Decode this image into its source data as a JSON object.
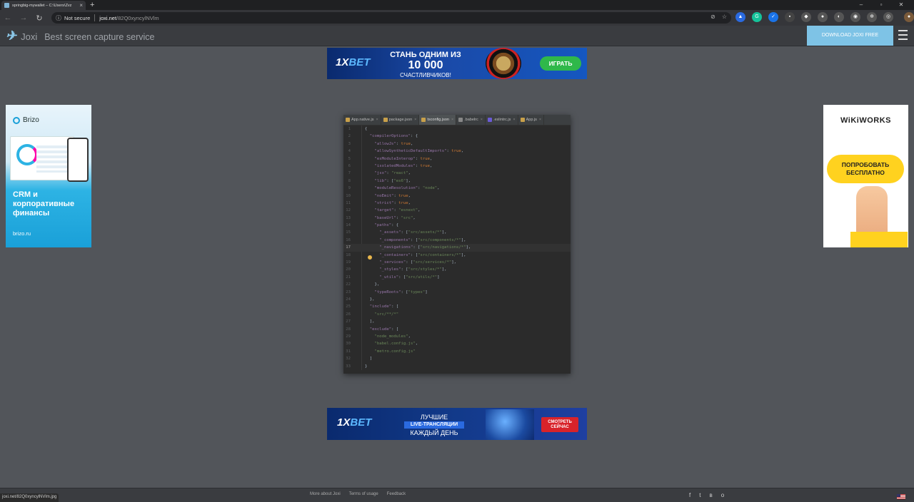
{
  "browser": {
    "tab_title": "springbig-mywallet – C:\\Users\\Zvz",
    "new_tab": "+",
    "security_label": "Not secure",
    "url_domain": "joxi.net",
    "url_path": "/82Q0xyncylNVlm",
    "status_url": "joxi.net/82Q0xyncylNVlm.jpg"
  },
  "joxi": {
    "logo": "Joxi",
    "tagline": "Best screen capture service",
    "download_label": "DOWNLOAD JOXI FREE"
  },
  "top_banner": {
    "brand_a": "1X",
    "brand_b": "BET",
    "line1": "СТАНЬ ОДНИМ ИЗ",
    "line2": "10 000",
    "line3": "СЧАСТЛИВЧИКОВ!",
    "cta": "ИГРАТЬ"
  },
  "bottom_banner": {
    "brand_a": "1X",
    "brand_b": "BET",
    "line1": "ЛУЧШИЕ",
    "line2": "LIVE-ТРАНСЛЯЦИИ",
    "line3": "КАЖДЫЙ ДЕНЬ",
    "cta_line1": "СМОТРЕТЬ",
    "cta_line2": "СЕЙЧАС"
  },
  "left_ad": {
    "brand": "Brizo",
    "text": "CRM и корпоративные финансы",
    "url": "brizo.ru"
  },
  "right_ad": {
    "brand": "WiKiWORKS",
    "cta": "ПОПРОБОВАТЬ БЕСПЛАТНО"
  },
  "editor": {
    "tabs": [
      {
        "label": "App.native.js",
        "active": false
      },
      {
        "label": "package.json",
        "active": false
      },
      {
        "label": "tsconfig.json",
        "active": true
      },
      {
        "label": ".babelrc",
        "active": false
      },
      {
        "label": ".eslintrc.js",
        "active": false
      },
      {
        "label": "App.js",
        "active": false
      }
    ],
    "current_line": 17,
    "lines": [
      "{",
      "  \"compilerOptions\": {",
      "    \"allowJs\": true,",
      "    \"allowSyntheticDefaultImports\": true,",
      "    \"esModuleInterop\": true,",
      "    \"isolatedModules\": true,",
      "    \"jsx\": \"react\",",
      "    \"lib\": [\"es6\"],",
      "    \"moduleResolution\": \"node\",",
      "    \"noEmit\": true,",
      "    \"strict\": true,",
      "    \"target\": \"esnext\",",
      "    \"baseUrl\": \"src\",",
      "    \"paths\": {",
      "      \"_assets\": [\"src/assets/*\"],",
      "      \"_components\": [\"src/components/*\"],",
      "      \"_navigations\": [\"src/navigations/*\"],",
      "      \"_containers\": [\"src/containers/*\"],",
      "      \"_services\": [\"src/services/*\"],",
      "      \"_styles\": [\"src/styles/*\"],",
      "      \"_utils\": [\"src/utils/*\"]",
      "    },",
      "    \"typeRoots\": [\"types\"]",
      "  },",
      "  \"include\": [",
      "    \"src/**/*\"",
      "  ],",
      "  \"exclude\": [",
      "    \"node_modules\",",
      "    \"babel.config.js\",",
      "    \"metro.config.js\"",
      "  ]",
      "}"
    ]
  },
  "footer": {
    "links": [
      "More about Joxi",
      "Terms of usage",
      "Feedback"
    ],
    "social": [
      "f",
      "t",
      "в",
      "о"
    ]
  },
  "colors": {
    "page_bg": "#52555a",
    "download_btn": "#7ec3e6",
    "editor_bg": "#2b2b2b"
  }
}
